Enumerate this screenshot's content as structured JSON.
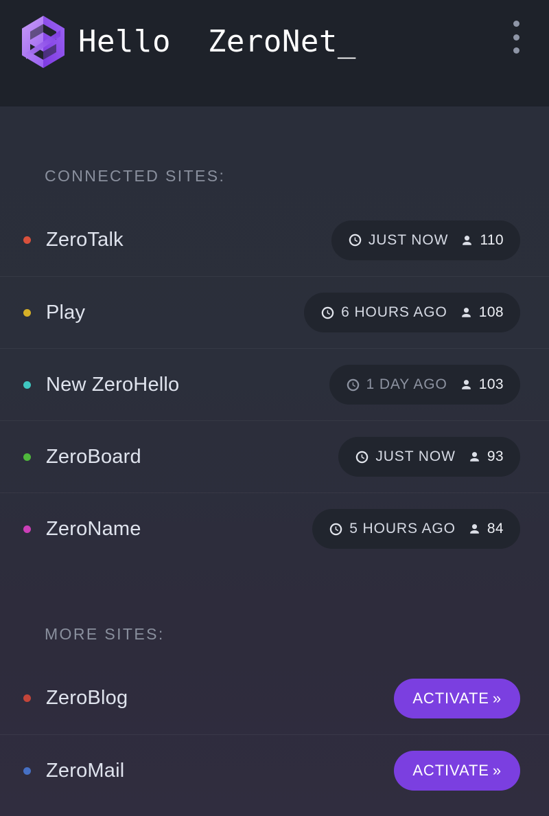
{
  "header": {
    "title": "Hello  ZeroNet_",
    "logo_icon": "zeronet-hexagon-logo",
    "menu_icon": "kebab-menu-icon",
    "background": "#1e222a"
  },
  "theme": {
    "accent": "#7b3fe0",
    "badge_bg": "#21252e",
    "page_bg": "#2b2f3b",
    "muted_text": "#8a909e"
  },
  "sections": {
    "connected": {
      "label": "CONNECTED SITES:",
      "rows": [
        {
          "name": "ZeroTalk",
          "dot_color": "#d9513c",
          "time": "JUST NOW",
          "peers": "110",
          "dim": false,
          "clock_icon": "clock-icon",
          "peer_icon": "person-icon"
        },
        {
          "name": "Play",
          "dot_color": "#d6b027",
          "time": "6 HOURS AGO",
          "peers": "108",
          "dim": false,
          "clock_icon": "clock-icon",
          "peer_icon": "person-icon"
        },
        {
          "name": "New ZeroHello",
          "dot_color": "#3fc7c0",
          "time": "1 DAY AGO",
          "peers": "103",
          "dim": true,
          "clock_icon": "clock-icon",
          "peer_icon": "person-icon"
        },
        {
          "name": "ZeroBoard",
          "dot_color": "#4fb83c",
          "time": "JUST NOW",
          "peers": "93",
          "dim": false,
          "clock_icon": "clock-icon",
          "peer_icon": "person-icon"
        },
        {
          "name": "ZeroName",
          "dot_color": "#cc3fb8",
          "time": "5 HOURS AGO",
          "peers": "84",
          "dim": false,
          "clock_icon": "clock-icon",
          "peer_icon": "person-icon"
        }
      ]
    },
    "more": {
      "label": "MORE SITES:",
      "rows": [
        {
          "name": "ZeroBlog",
          "dot_color": "#c4453a",
          "action_label": "ACTIVATE",
          "action_chevron": "»"
        },
        {
          "name": "ZeroMail",
          "dot_color": "#4670c4",
          "action_label": "ACTIVATE",
          "action_chevron": "»"
        }
      ]
    }
  }
}
